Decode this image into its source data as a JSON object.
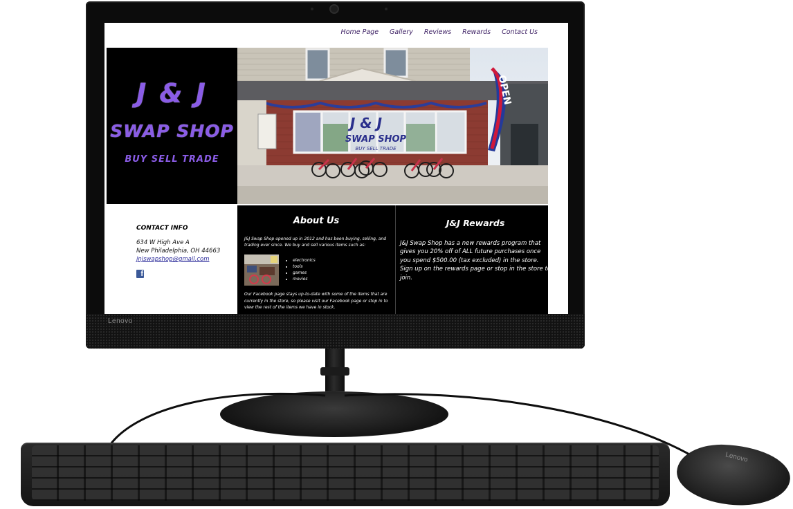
{
  "device": {
    "brand": "Lenovo",
    "mouse_brand": "Lenovo"
  },
  "nav": {
    "items": [
      "Home Page",
      "Gallery",
      "Reviews",
      "Rewards",
      "Contact Us"
    ]
  },
  "logo": {
    "line1": "J & J",
    "line2": "SWAP SHOP",
    "line3": "BUY SELL TRADE"
  },
  "contact": {
    "heading": "CONTACT INFO",
    "address1": "634 W High Ave A",
    "address2": "New Philadelphia, OH 44663",
    "email": "jnjswapshop@gmail.com",
    "facebook_icon": "facebook-icon"
  },
  "about": {
    "title": "About Us",
    "intro": "J&J Swap Shop opened up in 2012 and has been buying, selling, and trading ever since. We buy and sell various items such as:",
    "items": [
      "electronics",
      "tools",
      "games",
      "movies"
    ],
    "outro": "Our Facebook page stays up-to-date with some of the items that are currently in the store, so please visit our Facebook page or stop in to view the rest of the items we have in stock."
  },
  "rewards": {
    "title": "J&J Rewards",
    "body": "J&J Swap Shop has a new rewards program that gives you 20% off of ALL future purchases once you spend $500.00 (tax excluded) in the store. Sign up on the rewards page or stop in the store to join."
  },
  "storefront": {
    "window_sign_1": "J & J",
    "window_sign_2": "SWAP SHOP",
    "window_sign_3": "BUY SELL TRADE",
    "flag_text": "OPEN"
  },
  "colors": {
    "logo_purple": "#8a5ce6",
    "nav_purple": "#3c1f63",
    "link_blue": "#2a2a9a",
    "facebook_blue": "#3b5998"
  }
}
